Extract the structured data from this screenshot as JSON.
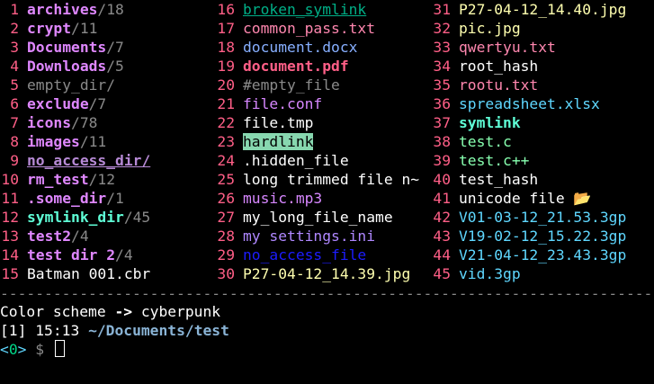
{
  "columns": [
    [
      {
        "num": "1",
        "name": "archives",
        "suffix": "/18",
        "style": "dir"
      },
      {
        "num": "2",
        "name": "crypt",
        "suffix": "/11",
        "style": "dir"
      },
      {
        "num": "3",
        "name": "Documents",
        "suffix": "/7",
        "style": "dir"
      },
      {
        "num": "4",
        "name": "Downloads",
        "suffix": "/5",
        "style": "dir"
      },
      {
        "num": "5",
        "name": "empty_dir/",
        "suffix": "",
        "style": "emptydir"
      },
      {
        "num": "6",
        "name": "exclude",
        "suffix": "/7",
        "style": "dir"
      },
      {
        "num": "7",
        "name": "icons",
        "suffix": "/78",
        "style": "dir"
      },
      {
        "num": "8",
        "name": "images",
        "suffix": "/11",
        "style": "dir"
      },
      {
        "num": "9",
        "name": "no_access_dir/",
        "suffix": "",
        "style": "dirnoacc"
      },
      {
        "num": "10",
        "name": "rm_test",
        "suffix": "/12",
        "style": "dir"
      },
      {
        "num": "11",
        "name": ".some_dir",
        "suffix": "/1",
        "style": "dir"
      },
      {
        "num": "12",
        "name": "symlink_dir",
        "suffix": "/45",
        "style": "symdir"
      },
      {
        "num": "13",
        "name": "test2",
        "suffix": "/4",
        "style": "dir"
      },
      {
        "num": "14",
        "name": "test dir 2",
        "suffix": "/4",
        "style": "dir"
      },
      {
        "num": "15",
        "name": "Batman 001.cbr",
        "suffix": "",
        "style": "white"
      }
    ],
    [
      {
        "num": "16",
        "name": "broken_symlink",
        "suffix": "",
        "style": "brokenlink"
      },
      {
        "num": "17",
        "name": "common_pass.txt",
        "suffix": "",
        "style": "pink"
      },
      {
        "num": "18",
        "name": "document.docx",
        "suffix": "",
        "style": "blue"
      },
      {
        "num": "19",
        "name": "document.pdf",
        "suffix": "",
        "style": "pinkbold"
      },
      {
        "num": "20",
        "name": "#empty_file",
        "suffix": "",
        "style": "grey"
      },
      {
        "num": "21",
        "name": "file.conf",
        "suffix": "",
        "style": "magenta"
      },
      {
        "num": "22",
        "name": "file.tmp",
        "suffix": "",
        "style": "white"
      },
      {
        "num": "23",
        "name": "hardlink",
        "suffix": "",
        "style": "hardlink"
      },
      {
        "num": "24",
        "name": ".hidden_file",
        "suffix": "",
        "style": "white"
      },
      {
        "num": "25",
        "name": "long trimmed file n~",
        "suffix": "",
        "style": "white"
      },
      {
        "num": "26",
        "name": "music.mp3",
        "suffix": "",
        "style": "magenta"
      },
      {
        "num": "27",
        "name": "my_long_file_name",
        "suffix": "",
        "style": "white"
      },
      {
        "num": "28",
        "name": "my settings.ini",
        "suffix": "",
        "style": "violet"
      },
      {
        "num": "29",
        "name": "no_access_file",
        "suffix": "",
        "style": "noaccess"
      },
      {
        "num": "30",
        "name": "P27-04-12_14.39.jpg",
        "suffix": "",
        "style": "yellow"
      }
    ],
    [
      {
        "num": "31",
        "name": "P27-04-12_14.40.jpg",
        "suffix": "",
        "style": "yellow"
      },
      {
        "num": "32",
        "name": "pic.jpg",
        "suffix": "",
        "style": "yellow"
      },
      {
        "num": "33",
        "name": "qwertyu.txt",
        "suffix": "",
        "style": "pink"
      },
      {
        "num": "34",
        "name": "root_hash",
        "suffix": "",
        "style": "white"
      },
      {
        "num": "35",
        "name": "rootu.txt",
        "suffix": "",
        "style": "pink"
      },
      {
        "num": "36",
        "name": "spreadsheet.xlsx",
        "suffix": "",
        "style": "cyan"
      },
      {
        "num": "37",
        "name": "symlink",
        "suffix": "",
        "style": "symfile"
      },
      {
        "num": "38",
        "name": "test.c",
        "suffix": "",
        "style": "green"
      },
      {
        "num": "39",
        "name": "test.c++",
        "suffix": "",
        "style": "green"
      },
      {
        "num": "40",
        "name": "test_hash",
        "suffix": "",
        "style": "white"
      },
      {
        "num": "41",
        "name": "unicode file 📂",
        "suffix": "",
        "style": "white"
      },
      {
        "num": "42",
        "name": "V01-03-12_21.53.3gp",
        "suffix": "",
        "style": "cyan"
      },
      {
        "num": "43",
        "name": "V19-02-12_15.22.3gp",
        "suffix": "",
        "style": "cyan"
      },
      {
        "num": "44",
        "name": "V21-04-12_23.43.3gp",
        "suffix": "",
        "style": "cyan"
      },
      {
        "num": "45",
        "name": "vid.3gp",
        "suffix": "",
        "style": "cyan"
      }
    ]
  ],
  "separator": "------------------------------------------------------------------------------------------------",
  "status": {
    "scheme_prefix": "Color scheme ",
    "scheme_arrow": "->",
    "scheme_name": " cyberpunk",
    "context": "[1]",
    "time": "15:13",
    "path": "~/Documents/test",
    "prompt_ctx_open": "<",
    "prompt_ctx_num": "0",
    "prompt_ctx_close": ">",
    "prompt_symbol": "$"
  }
}
